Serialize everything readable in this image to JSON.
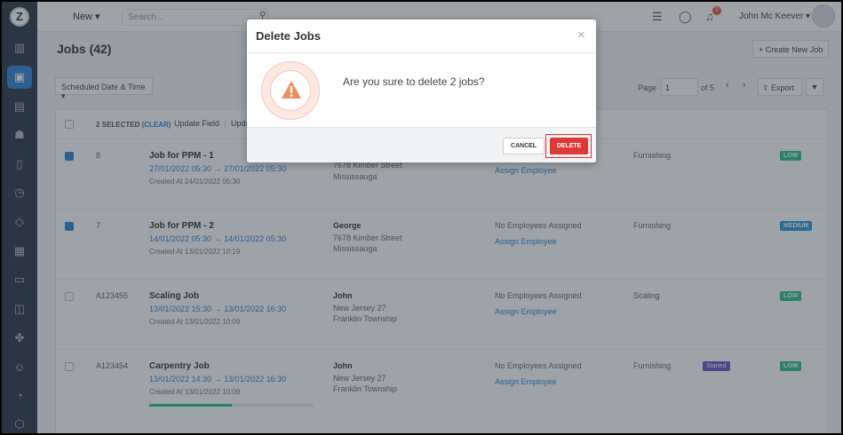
{
  "topbar": {
    "new_label": "New ▾",
    "search_placeholder": "Search...",
    "notification_count": "3",
    "user_name": "John Mc Keever ▾"
  },
  "page": {
    "title": "Jobs (42)",
    "create_button": "+ Create New Job",
    "filter_select": "Scheduled Date & Time ▾",
    "page_label": "Page",
    "page_value": "1",
    "page_of": "of 5",
    "export_label": "Export"
  },
  "bulk": {
    "selected_text": "2 SELECTED",
    "clear_text": "(CLEAR)",
    "update_field": "Update Field",
    "update_more": "Upda"
  },
  "rows": [
    {
      "id": "8",
      "checked": true,
      "title": "Job for PPM - 1",
      "dates": "27/01/2022 05:30 → 27/01/2022 05:30",
      "created": "Created At 24/01/2022 05:30",
      "client": "",
      "addr1": "7678 Kimber Street",
      "addr2": "Mississauga",
      "employees": "",
      "assign": "Assign Employee",
      "service": "Furnishing",
      "status": "",
      "priority": "LOW"
    },
    {
      "id": "7",
      "checked": true,
      "title": "Job for PPM - 2",
      "dates": "14/01/2022 05:30 → 14/01/2022 05:30",
      "created": "Created At 13/01/2022 10:19",
      "client": "George",
      "addr1": "7678 Kimber Street",
      "addr2": "Mississauga",
      "employees": "No Employees Assigned",
      "assign": "Assign Employee",
      "service": "Furnishing",
      "status": "",
      "priority": "MEDIUM"
    },
    {
      "id": "A123455",
      "checked": false,
      "title": "Scaling Job",
      "dates": "13/01/2022 15:30 → 13/01/2022 16:30",
      "created": "Created At 13/01/2022 10:09",
      "client": "John",
      "addr1": "New Jersey 27",
      "addr2": "Franklin Township",
      "employees": "No Employees Assigned",
      "assign": "Assign Employee",
      "service": "Scaling",
      "status": "",
      "priority": "LOW"
    },
    {
      "id": "A123454",
      "checked": false,
      "title": "Carpentry Job",
      "dates": "13/01/2022 14:30 → 13/01/2022 16:30",
      "created": "Created At 13/01/2022 10:09",
      "client": "John",
      "addr1": "New Jersey 27",
      "addr2": "Franklin Township",
      "employees": "No Employees Assigned",
      "assign": "Assign Employee",
      "service": "Furnishing",
      "status": "Started",
      "priority": "LOW",
      "progress": 0.5
    }
  ],
  "modal": {
    "title": "Delete Jobs",
    "close": "×",
    "message": "Are you sure to delete 2 jobs?",
    "cancel": "CANCEL",
    "delete": "DELETE"
  }
}
